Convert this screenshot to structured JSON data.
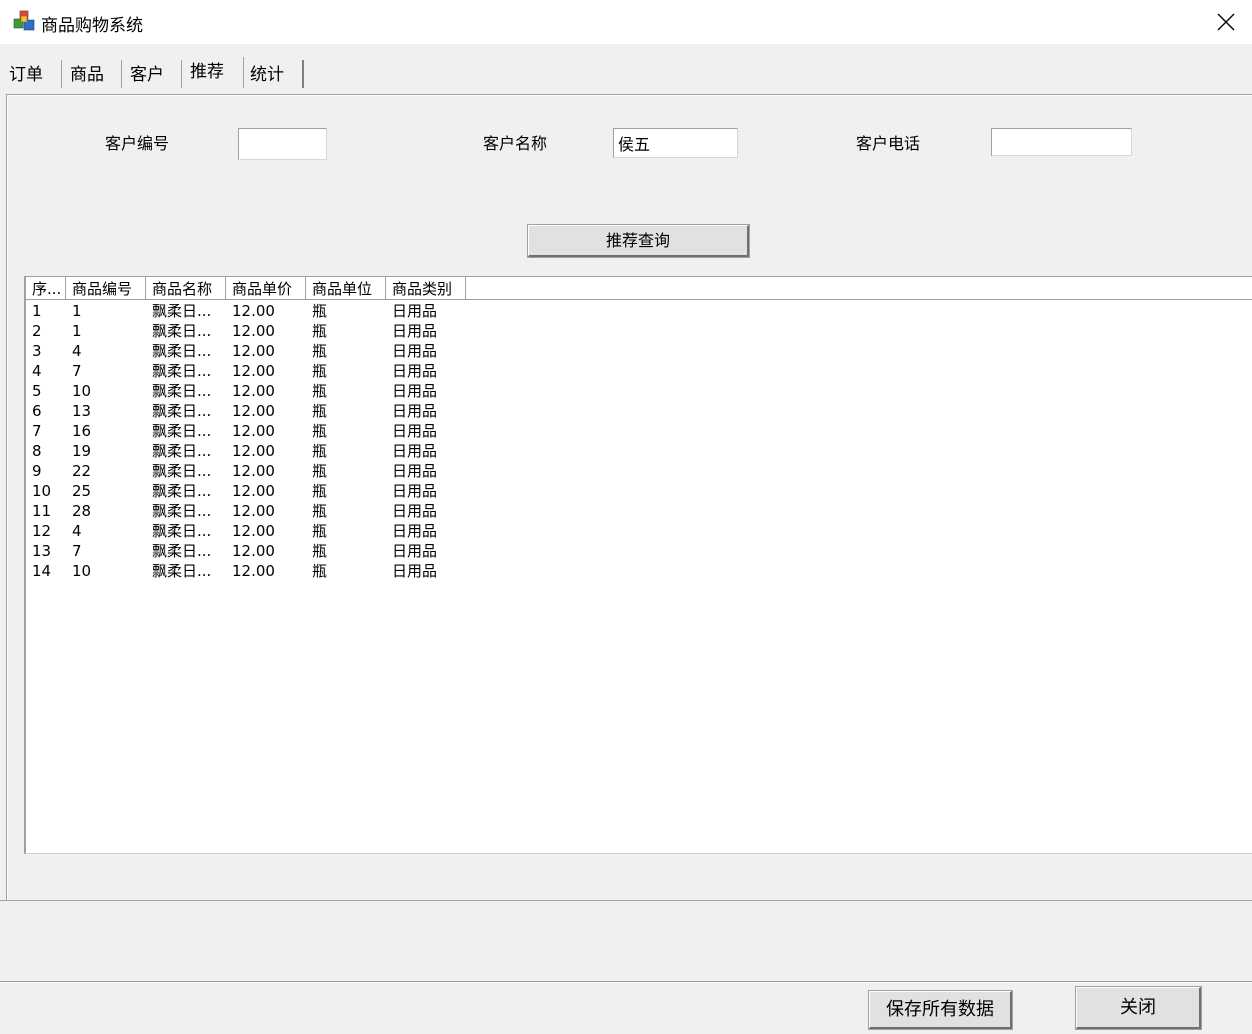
{
  "window": {
    "title": "商品购物系统"
  },
  "tabs": [
    {
      "label": "订单"
    },
    {
      "label": "商品"
    },
    {
      "label": "客户"
    },
    {
      "label": "推荐"
    },
    {
      "label": "统计"
    }
  ],
  "form": {
    "customer_id_label": "客户编号",
    "customer_id_value": "",
    "customer_name_label": "客户名称",
    "customer_name_value": "侯五",
    "customer_phone_label": "客户电话",
    "customer_phone_value": "",
    "query_button": "推荐查询"
  },
  "grid": {
    "columns": [
      "序...",
      "商品编号",
      "商品名称",
      "商品单价",
      "商品单位",
      "商品类别"
    ],
    "rows": [
      [
        "1",
        "1",
        "飘柔日...",
        "12.00",
        "瓶",
        "日用品"
      ],
      [
        "2",
        "1",
        "飘柔日...",
        "12.00",
        "瓶",
        "日用品"
      ],
      [
        "3",
        "4",
        "飘柔日...",
        "12.00",
        "瓶",
        "日用品"
      ],
      [
        "4",
        "7",
        "飘柔日...",
        "12.00",
        "瓶",
        "日用品"
      ],
      [
        "5",
        "10",
        "飘柔日...",
        "12.00",
        "瓶",
        "日用品"
      ],
      [
        "6",
        "13",
        "飘柔日...",
        "12.00",
        "瓶",
        "日用品"
      ],
      [
        "7",
        "16",
        "飘柔日...",
        "12.00",
        "瓶",
        "日用品"
      ],
      [
        "8",
        "19",
        "飘柔日...",
        "12.00",
        "瓶",
        "日用品"
      ],
      [
        "9",
        "22",
        "飘柔日...",
        "12.00",
        "瓶",
        "日用品"
      ],
      [
        "10",
        "25",
        "飘柔日...",
        "12.00",
        "瓶",
        "日用品"
      ],
      [
        "11",
        "28",
        "飘柔日...",
        "12.00",
        "瓶",
        "日用品"
      ],
      [
        "12",
        "4",
        "飘柔日...",
        "12.00",
        "瓶",
        "日用品"
      ],
      [
        "13",
        "7",
        "飘柔日...",
        "12.00",
        "瓶",
        "日用品"
      ],
      [
        "14",
        "10",
        "飘柔日...",
        "12.00",
        "瓶",
        "日用品"
      ]
    ]
  },
  "footer": {
    "save_button": "保存所有数据",
    "close_button": "关闭"
  },
  "icons": {
    "app": "app-cubes-icon",
    "close": "close-icon"
  }
}
